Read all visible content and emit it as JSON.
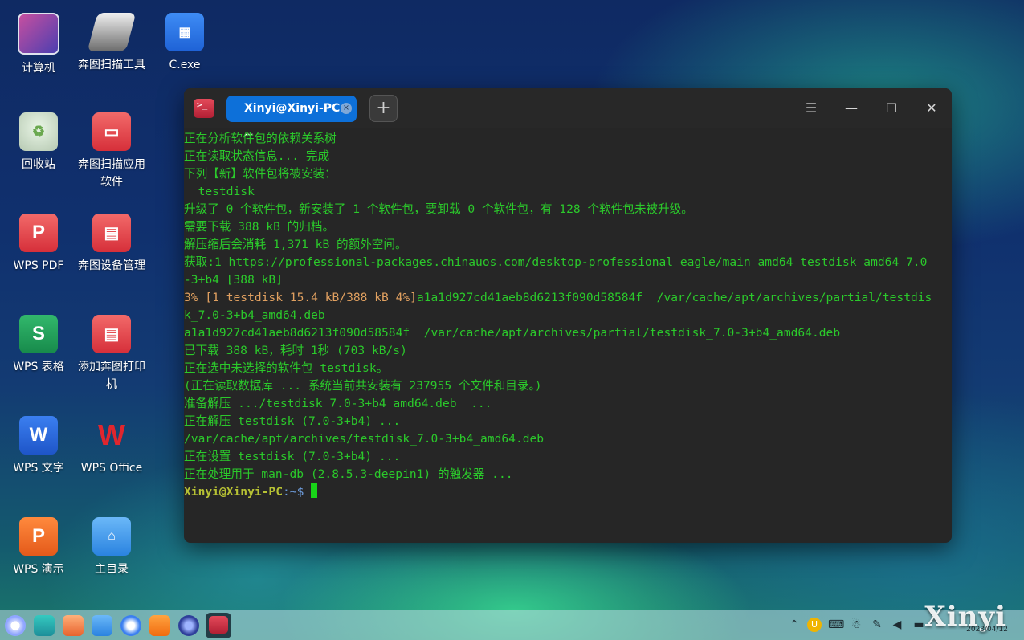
{
  "desktop": {
    "icons": [
      {
        "label": "计算机"
      },
      {
        "label": "奔图扫描工具"
      },
      {
        "label": "C.exe"
      },
      {
        "label": "回收站"
      },
      {
        "label": "奔图扫描应用软件"
      },
      {
        "label": "WPS PDF"
      },
      {
        "label": "奔图设备管理"
      },
      {
        "label": "WPS 表格"
      },
      {
        "label": "添加奔图打印机"
      },
      {
        "label": "WPS 文字"
      },
      {
        "label": "WPS Office"
      },
      {
        "label": "WPS 演示"
      },
      {
        "label": "主目录"
      }
    ]
  },
  "terminal": {
    "tab_title": "Xinyi@Xinyi-PC: ~",
    "lines": [
      "正在分析软件包的依赖关系树",
      "正在读取状态信息... 完成",
      "下列【新】软件包将被安装：",
      "  testdisk",
      "升级了 0 个软件包，新安装了 1 个软件包，要卸载 0 个软件包，有 128 个软件包未被升级。",
      "需要下载 388 kB 的归档。",
      "解压缩后会消耗 1,371 kB 的额外空间。",
      "获取:1 https://professional-packages.chinauos.com/desktop-professional eagle/main amd64 testdisk amd64 7.0",
      "-3+b4 [388 kB]"
    ],
    "progress_prefix": "3% [1 testdisk 15.4 kB/388 kB 4%]",
    "progress_rest": "a1a1d927cd41aeb8d6213f090d58584f  /var/cache/apt/archives/partial/testdis",
    "lines2": [
      "k_7.0-3+b4_amd64.deb",
      "a1a1d927cd41aeb8d6213f090d58584f  /var/cache/apt/archives/partial/testdisk_7.0-3+b4_amd64.deb",
      "已下载 388 kB，耗时 1秒 (703 kB/s)",
      "正在选中未选择的软件包 testdisk。",
      "(正在读取数据库 ... 系统当前共安装有 237955 个文件和目录。)",
      "准备解压 .../testdisk_7.0-3+b4_amd64.deb  ...",
      "正在解压 testdisk (7.0-3+b4) ...",
      "/var/cache/apt/archives/testdisk_7.0-3+b4_amd64.deb",
      "正在设置 testdisk (7.0-3+b4) ...",
      "正在处理用于 man-db (2.8.5.3-deepin1) 的触发器 ..."
    ],
    "prompt_user": "Xinyi@Xinyi-PC",
    "prompt_path": ":~$ "
  },
  "watermark": "Xinyi",
  "clock": "2023/04/12"
}
